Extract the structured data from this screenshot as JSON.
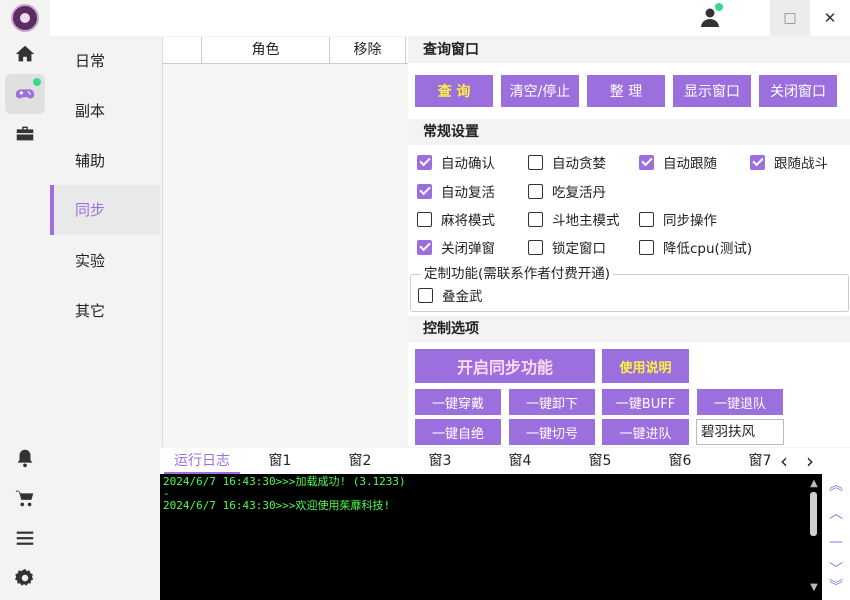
{
  "app": {
    "title": "",
    "window": {
      "minimize": "—",
      "maximize": "□",
      "close": "✕"
    }
  },
  "rail": {
    "items": [
      {
        "icon": "home-icon"
      },
      {
        "icon": "gamepad-icon"
      },
      {
        "icon": "toolbox-icon"
      },
      {
        "icon": "bell-icon"
      },
      {
        "icon": "cart-icon"
      },
      {
        "icon": "menu-icon"
      },
      {
        "icon": "settings-icon"
      }
    ],
    "status_color": "#39d98a"
  },
  "nav": {
    "items": [
      "日常",
      "副本",
      "辅助",
      "同步",
      "实验",
      "其它"
    ],
    "active": "同步"
  },
  "table": {
    "columns": [
      "",
      "角色",
      "移除"
    ],
    "rows": []
  },
  "query": {
    "header": "查询窗口",
    "buttons": [
      "查 询",
      "清空/停止",
      "整 理",
      "显示窗口",
      "关闭窗口"
    ]
  },
  "general": {
    "header": "常规设置",
    "options": [
      {
        "label": "自动确认",
        "checked": true
      },
      {
        "label": "自动贪婪",
        "checked": false
      },
      {
        "label": "自动跟随",
        "checked": true
      },
      {
        "label": "跟随战斗",
        "checked": true
      },
      {
        "label": "自动复活",
        "checked": true
      },
      {
        "label": "吃复活丹",
        "checked": false
      },
      {
        "label": "麻将模式",
        "checked": false
      },
      {
        "label": "斗地主模式",
        "checked": false
      },
      {
        "label": "同步操作",
        "checked": false
      },
      {
        "label": "关闭弹窗",
        "checked": true
      },
      {
        "label": "锁定窗口",
        "checked": false
      },
      {
        "label": "降低cpu(测试)",
        "checked": false
      }
    ]
  },
  "custom": {
    "legend": "定制功能(需联系作者付费开通)",
    "options": [
      {
        "label": "叠金武",
        "checked": false
      }
    ]
  },
  "control": {
    "header": "控制选项",
    "start_label": "开启同步功能",
    "help_label": "使用说明",
    "actions": [
      "一键穿戴",
      "一键卸下",
      "一键BUFF",
      "一键退队",
      "一键自绝",
      "一键切号",
      "一键进队"
    ],
    "name_value": "碧羽扶风"
  },
  "log": {
    "tabs": [
      "运行日志",
      "窗1",
      "窗2",
      "窗3",
      "窗4",
      "窗5",
      "窗6",
      "窗7"
    ],
    "active_tab": "运行日志",
    "prev": "‹",
    "next": "›",
    "lines": [
      "2024/6/7 16:43:30>>>加载成功! (3.1233)",
      "-",
      "2024/6/7 16:43:30>>>欢迎使用茱蘼科技!"
    ]
  },
  "colors": {
    "accent": "#9b6fde",
    "log_text": "#4dff4d"
  }
}
